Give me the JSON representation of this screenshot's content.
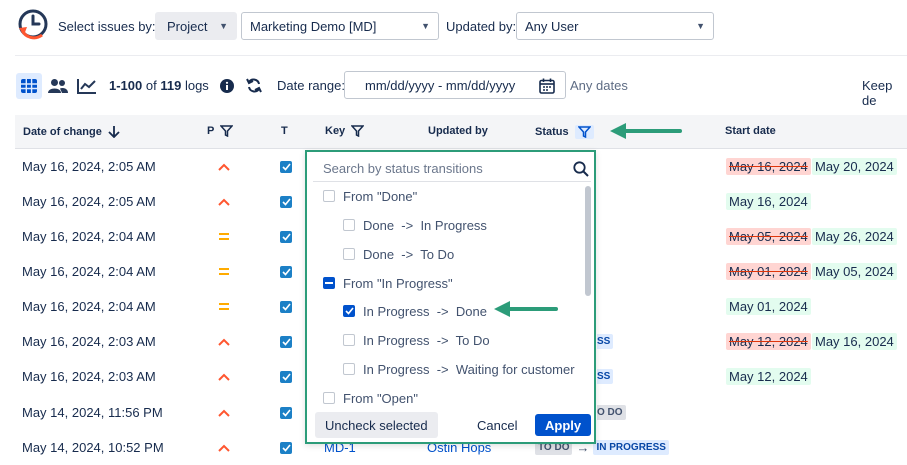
{
  "colors": {
    "accent": "#0052cc",
    "checkbox": "#1c80c6",
    "arrow": "#2c9c79",
    "priority_high": "#ff5630",
    "priority_medium": "#ffab00"
  },
  "header": {
    "select_issues_label": "Select issues by:",
    "scope_select": "Project",
    "project_select": "Marketing Demo [MD]",
    "updated_by_label": "Updated by:",
    "updated_by_select": "Any User"
  },
  "toolbar": {
    "range_start": "1-100",
    "range_of": "of",
    "total": "119",
    "logs": "logs",
    "date_range_label": "Date range:",
    "date_placeholder": "mm/dd/yyyy - mm/dd/yyyy",
    "any_dates": "Any dates",
    "keep": "Keep de"
  },
  "columns": {
    "date_of_change": "Date of change",
    "p": "P",
    "t": "T",
    "key": "Key",
    "updated_by": "Updated by",
    "status": "Status",
    "start_date": "Start date"
  },
  "rows": [
    {
      "date": "May 16, 2024, 2:05 AM",
      "priority": "high",
      "old": "May 16, 2024",
      "new": "May 20, 2024"
    },
    {
      "date": "May 16, 2024, 2:05 AM",
      "priority": "high",
      "old": "",
      "new": "May 16, 2024"
    },
    {
      "date": "May 16, 2024, 2:04 AM",
      "priority": "medium",
      "old": "May 05, 2024",
      "new": "May 26, 2024"
    },
    {
      "date": "May 16, 2024, 2:04 AM",
      "priority": "medium",
      "old": "May 01, 2024",
      "new": "May 05, 2024"
    },
    {
      "date": "May 16, 2024, 2:04 AM",
      "priority": "medium",
      "old": "",
      "new": "May 01, 2024"
    },
    {
      "date": "May 16, 2024, 2:03 AM",
      "priority": "high",
      "old": "May 12, 2024",
      "new": "May 16, 2024",
      "status_tail": "SS"
    },
    {
      "date": "May 16, 2024, 2:03 AM",
      "priority": "high",
      "old": "",
      "new": "May 12, 2024",
      "status_tail": "SS"
    },
    {
      "date": "May 14, 2024, 11:56 PM",
      "priority": "high",
      "status_tail": "O DO"
    },
    {
      "date": "May 14, 2024, 10:52 PM",
      "priority": "high",
      "key": "MD-1",
      "updated_by": "Ostin Hops",
      "status_from": "TO DO",
      "status_to": "IN PROGRESS"
    }
  ],
  "dropdown": {
    "search_placeholder": "Search by status transitions",
    "items": [
      {
        "label": "From \"Done\"",
        "level": 0,
        "state": "unchecked"
      },
      {
        "label": "Done  ->  In Progress",
        "level": 1,
        "state": "unchecked"
      },
      {
        "label": "Done  ->  To Do",
        "level": 1,
        "state": "unchecked"
      },
      {
        "label": "From \"In Progress\"",
        "level": 0,
        "state": "partial"
      },
      {
        "label": "In Progress  ->  Done",
        "level": 1,
        "state": "checked"
      },
      {
        "label": "In Progress  ->  To Do",
        "level": 1,
        "state": "unchecked"
      },
      {
        "label": "In Progress  ->  Waiting for customer",
        "level": 1,
        "state": "unchecked"
      },
      {
        "label": "From \"Open\"",
        "level": 0,
        "state": "unchecked"
      }
    ],
    "uncheck_label": "Uncheck selected",
    "cancel_label": "Cancel",
    "apply_label": "Apply"
  }
}
